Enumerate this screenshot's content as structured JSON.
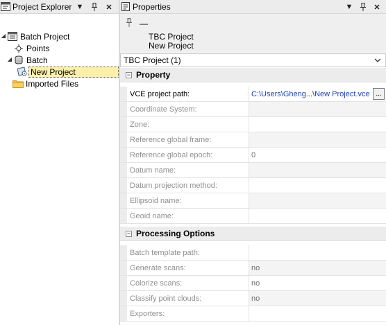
{
  "explorer": {
    "title": "Project Explorer",
    "controls": {
      "menu": "▼",
      "pin": "⊥",
      "close": "✕"
    },
    "tree": [
      {
        "label": "Batch Project",
        "icon": "batch-project-icon",
        "expanded": true
      },
      {
        "label": "Points",
        "icon": "points-icon"
      },
      {
        "label": "Batch",
        "icon": "batch-icon",
        "expanded": true
      },
      {
        "label": "New Project",
        "icon": "new-project-icon",
        "selected": true
      },
      {
        "label": "Imported Files",
        "icon": "folder-icon"
      }
    ]
  },
  "properties": {
    "title": "Properties",
    "controls": {
      "menu": "▼",
      "pin": "⊥",
      "close": "✕"
    },
    "pin_label": "—",
    "object_names": [
      "TBC Project",
      "New Project"
    ],
    "combo_value": "TBC Project (1)",
    "categories": [
      {
        "label": "Property",
        "rows": [
          {
            "name": "VCE project path:",
            "value": "C:\\Users\\Gheng...\\New Project.vce",
            "enabled": true,
            "has_browse": true,
            "browse_label": "..."
          },
          {
            "name": "Coordinate System:",
            "value": "",
            "enabled": false,
            "value_bg": "ro"
          },
          {
            "name": "Zone:",
            "value": "",
            "enabled": false,
            "value_bg": "edit"
          },
          {
            "name": "Reference global frame:",
            "value": "",
            "enabled": false,
            "value_bg": "ro"
          },
          {
            "name": "Reference global epoch:",
            "value": "0",
            "enabled": false,
            "value_bg": "edit"
          },
          {
            "name": "Datum name:",
            "value": "",
            "enabled": false,
            "value_bg": "ro"
          },
          {
            "name": "Datum projection method:",
            "value": "",
            "enabled": false,
            "value_bg": "edit"
          },
          {
            "name": "Ellipsoid name:",
            "value": "",
            "enabled": false,
            "value_bg": "ro"
          },
          {
            "name": "Geoid name:",
            "value": "",
            "enabled": false,
            "value_bg": "edit"
          }
        ]
      },
      {
        "label": "Processing Options",
        "rows": [
          {
            "name": "Batch template path:",
            "value": "",
            "enabled": false,
            "value_bg": "edit"
          },
          {
            "name": "Generate scans:",
            "value": "no",
            "enabled": false,
            "value_bg": "ro"
          },
          {
            "name": "Colorize scans:",
            "value": "no",
            "enabled": false,
            "value_bg": "edit"
          },
          {
            "name": "Classify point clouds:",
            "value": "no",
            "enabled": false,
            "value_bg": "ro"
          },
          {
            "name": "Exporters:",
            "value": "",
            "enabled": false,
            "value_bg": "edit"
          }
        ]
      }
    ]
  },
  "colors": {
    "selection": "#fcefaa",
    "link": "#1a3fb5",
    "header_bg": "#ececec"
  }
}
